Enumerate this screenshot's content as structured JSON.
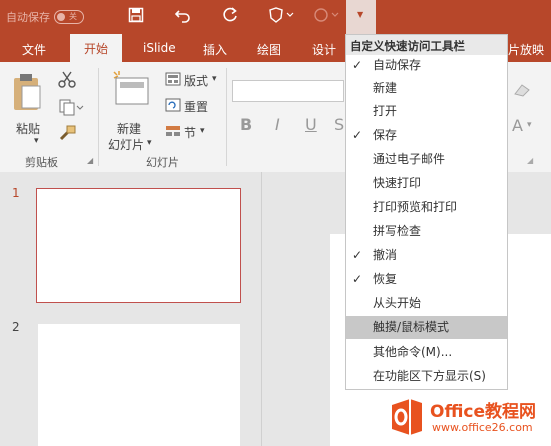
{
  "titlebar": {
    "autosave_label": "自动保存",
    "autosave_state": "关"
  },
  "tabs": [
    "文件",
    "开始",
    "iSlide",
    "插入",
    "绘图",
    "设计",
    "片放映"
  ],
  "ribbon": {
    "paste": "粘贴",
    "clipboard_group": "剪贴板",
    "new_slide_line1": "新建",
    "new_slide_line2": "幻灯片",
    "layout": "版式",
    "reset": "重置",
    "section": "节",
    "slides_group": "幻灯片",
    "font_b": "B",
    "font_i": "I",
    "font_u": "U",
    "font_s": "S",
    "a_label": "A"
  },
  "thumbnails": [
    {
      "num": "1"
    },
    {
      "num": "2"
    }
  ],
  "menu": {
    "title": "自定义快速访问工具栏",
    "items": [
      {
        "label": "自动保存",
        "checked": true
      },
      {
        "label": "新建",
        "checked": false
      },
      {
        "label": "打开",
        "checked": false
      },
      {
        "label": "保存",
        "checked": true
      },
      {
        "label": "通过电子邮件",
        "checked": false
      },
      {
        "label": "快速打印",
        "checked": false
      },
      {
        "label": "打印预览和打印",
        "checked": false
      },
      {
        "label": "拼写检查",
        "checked": false
      },
      {
        "label": "撤消",
        "checked": true
      },
      {
        "label": "恢复",
        "checked": true
      },
      {
        "label": "从头开始",
        "checked": false
      },
      {
        "label": "触摸/鼠标模式",
        "checked": false,
        "highlighted": true
      },
      {
        "label": "其他命令(M)...",
        "checked": false
      },
      {
        "label": "在功能区下方显示(S)",
        "checked": false
      }
    ]
  },
  "watermark": {
    "brand": "Office教程网",
    "url": "www.office26.com"
  }
}
